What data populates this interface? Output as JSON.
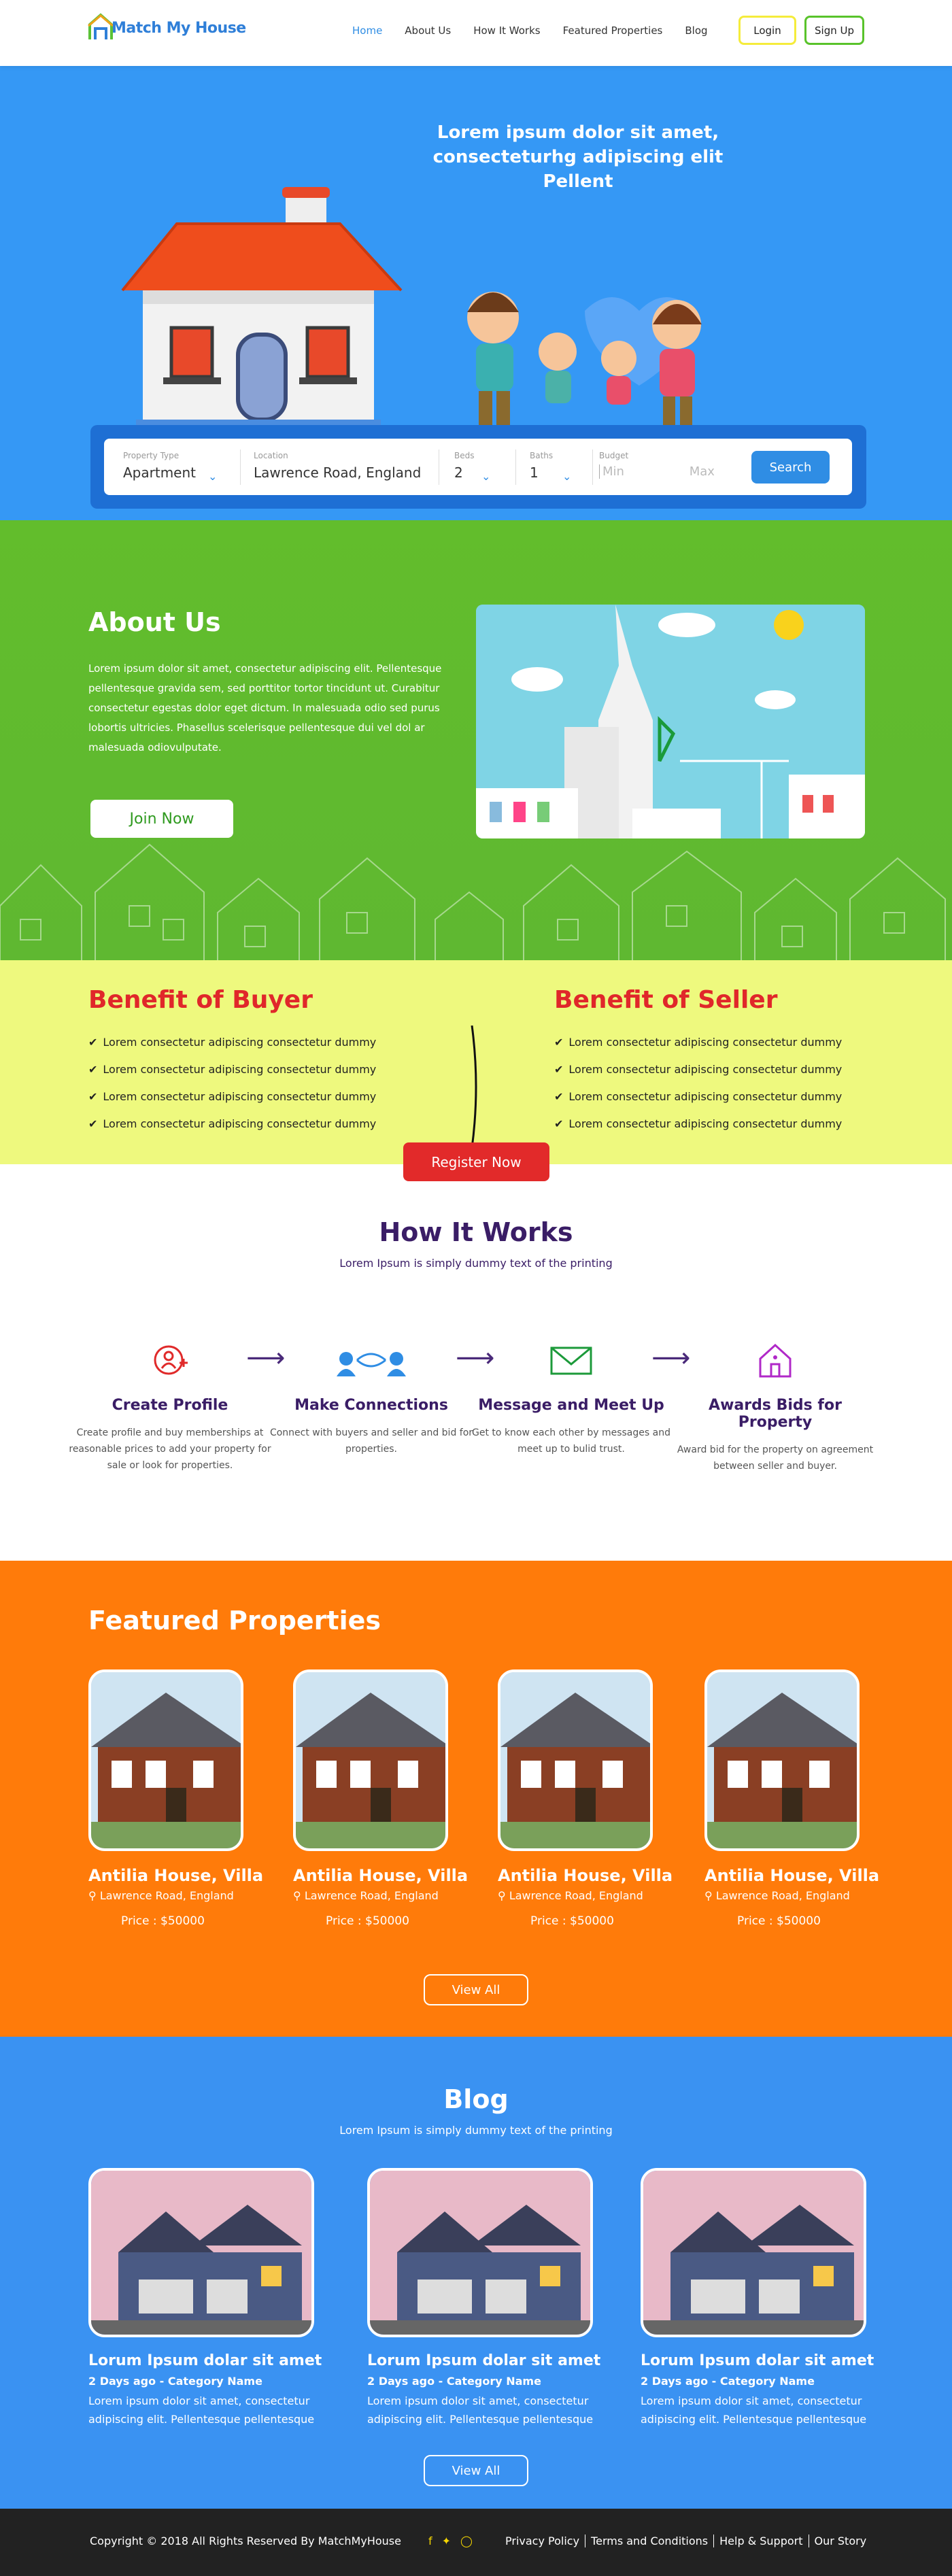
{
  "header": {
    "logo_text": "Match My House",
    "nav": [
      "Home",
      "About Us",
      "How It Works",
      "Featured Properties",
      "Blog"
    ],
    "login_label": "Login",
    "signup_label": "Sign Up"
  },
  "hero": {
    "title": "Lorem ipsum dolor sit amet, consecteturhg adipiscing elit Pellent",
    "search": {
      "property_type_label": "Property Type",
      "property_type_value": "Apartment",
      "location_label": "Location",
      "location_value": "Lawrence Road, England",
      "beds_label": "Beds",
      "beds_value": "2",
      "baths_label": "Baths",
      "baths_value": "1",
      "budget_label": "Budget",
      "budget_min_placeholder": "Min",
      "budget_max_placeholder": "Max",
      "search_label": "Search"
    }
  },
  "about": {
    "title": "About Us",
    "text": "Lorem ipsum dolor sit amet, consectetur adipiscing elit. Pellentesque pellentesque gravida sem, sed porttitor tortor tincidunt ut. Curabitur consectetur egestas dolor eget dictum. In malesuada odio sed purus lobortis ultricies. Phasellus scelerisque pellentesque dui vel dol ar malesuada odiovulputate.",
    "join_label": "Join Now"
  },
  "benefits": {
    "buyer_title": "Benefit of Buyer",
    "seller_title": "Benefit of Seller",
    "buyer_items": [
      "Lorem consectetur adipiscing  consectetur dummy",
      "Lorem consectetur adipiscing  consectetur dummy",
      "Lorem consectetur adipiscing  consectetur dummy",
      "Lorem consectetur adipiscing  consectetur dummy"
    ],
    "seller_items": [
      "Lorem consectetur adipiscing  consectetur dummy",
      "Lorem consectetur adipiscing  consectetur dummy",
      "Lorem consectetur adipiscing  consectetur dummy",
      "Lorem consectetur adipiscing  consectetur dummy"
    ],
    "register_label": "Register Now"
  },
  "how": {
    "title": "How It Works",
    "subtitle": "Lorem Ipsum is simply dummy text of the printing",
    "steps": [
      {
        "title": "Create Profile",
        "desc": "Create profile and buy memberships at reasonable prices to add your property for sale or look for properties."
      },
      {
        "title": "Make Connections",
        "desc": "Connect with buyers and seller and bid for properties."
      },
      {
        "title": "Message and Meet Up",
        "desc": "Get to know each other by messages and meet up to bulid trust."
      },
      {
        "title": "Awards Bids for Property",
        "desc": "Award bid for the property on agreement between seller and buyer."
      }
    ]
  },
  "featured": {
    "title": "Featured Properties",
    "cards": [
      {
        "name": "Antilia House, Villa",
        "location": "Lawrence Road, England",
        "price": "Price : $50000"
      },
      {
        "name": "Antilia House, Villa",
        "location": "Lawrence Road, England",
        "price": "Price : $50000"
      },
      {
        "name": "Antilia House, Villa",
        "location": "Lawrence Road, England",
        "price": "Price : $50000"
      },
      {
        "name": "Antilia House, Villa",
        "location": "Lawrence Road, England",
        "price": "Price : $50000"
      }
    ],
    "view_all_label": "View All"
  },
  "blog": {
    "title": "Blog",
    "subtitle": "Lorem Ipsum is simply dummy text of the printing",
    "posts": [
      {
        "title": "Lorum Ipsum dolar sit amet",
        "meta": "2 Days ago - Category Name",
        "excerpt": "Lorem ipsum dolor sit amet, consectetur adipiscing elit. Pellentesque pellentesque"
      },
      {
        "title": "Lorum Ipsum dolar sit amet",
        "meta": "2 Days ago - Category Name",
        "excerpt": "Lorem ipsum dolor sit amet, consectetur adipiscing elit. Pellentesque pellentesque"
      },
      {
        "title": "Lorum Ipsum dolar sit amet",
        "meta": "2 Days ago - Category Name",
        "excerpt": "Lorem ipsum dolor sit amet, consectetur adipiscing elit. Pellentesque pellentesque"
      }
    ],
    "view_all_label": "View All"
  },
  "footer": {
    "copyright": "Copyright © 2018 All Rights Reserved By MatchMyHouse",
    "links": [
      "Privacy Policy",
      "Terms and Conditions",
      "Help & Support",
      "Our Story"
    ]
  },
  "colors": {
    "hero_blue": "#3598f5",
    "about_green": "#62bd2c",
    "benefit_yellow": "#eef97e",
    "accent_red": "#e22a2a",
    "featured_orange": "#ff7b0a",
    "blog_blue": "#3a92f2",
    "footer_dark": "#222222",
    "how_purple": "#3a1d66"
  }
}
